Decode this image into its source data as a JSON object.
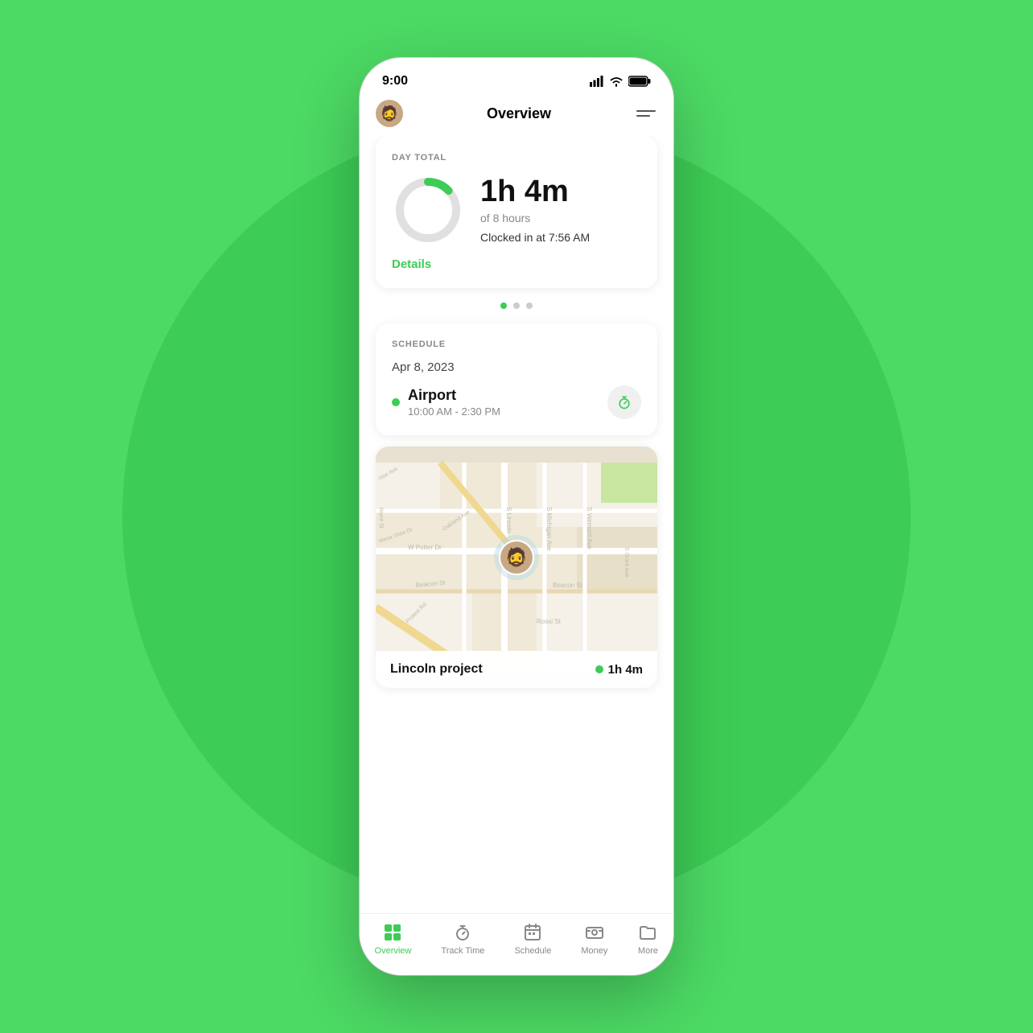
{
  "background": {
    "circle_color": "#3dcc55"
  },
  "status_bar": {
    "time": "9:00"
  },
  "nav_bar": {
    "title": "Overview",
    "menu_label": "menu"
  },
  "day_total_card": {
    "label": "DAY TOTAL",
    "time": "1h 4m",
    "of_hours": "of 8 hours",
    "clocked_in": "Clocked in at 7:56 AM",
    "details_link": "Details",
    "donut_progress": 13,
    "donut_total": 100
  },
  "dots": [
    {
      "active": true
    },
    {
      "active": false
    },
    {
      "active": false
    }
  ],
  "schedule_card": {
    "label": "SCHEDULE",
    "date": "Apr 8, 2023",
    "location": "Airport",
    "time_range": "10:00 AM - 2:30 PM"
  },
  "map_section": {
    "project_name": "Lincoln project",
    "project_time": "1h 4m"
  },
  "bottom_nav": {
    "items": [
      {
        "label": "Overview",
        "active": true,
        "icon": "grid"
      },
      {
        "label": "Track Time",
        "active": false,
        "icon": "timer"
      },
      {
        "label": "Schedule",
        "active": false,
        "icon": "calendar"
      },
      {
        "label": "Money",
        "active": false,
        "icon": "money"
      },
      {
        "label": "More",
        "active": false,
        "icon": "folder"
      }
    ]
  }
}
